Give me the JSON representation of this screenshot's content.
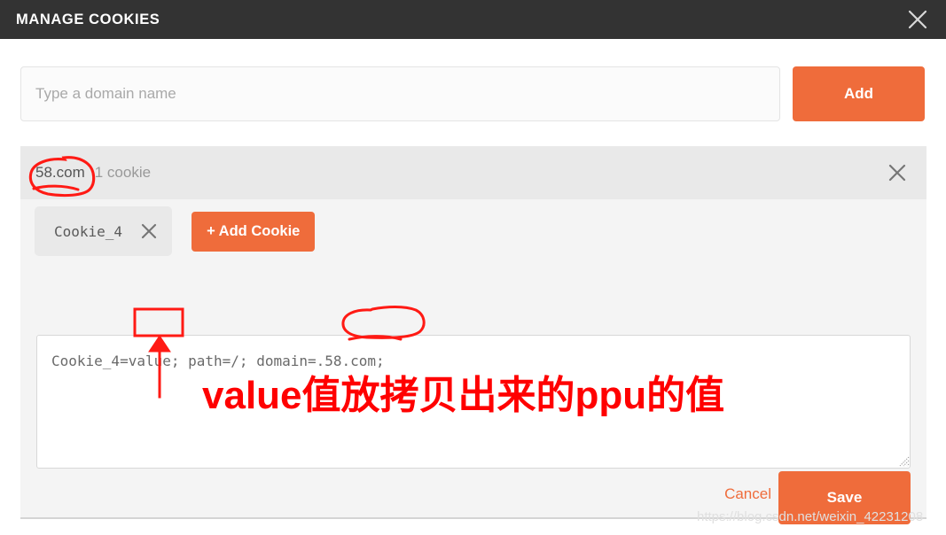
{
  "titlebar": {
    "title": "MANAGE COOKIES",
    "close_icon": "close-icon"
  },
  "add_row": {
    "domain_input_value": "",
    "domain_input_placeholder": "Type a domain name",
    "add_label": "Add"
  },
  "domain_card": {
    "domain_name": "58.com",
    "cookie_count_label": "1 cookie",
    "close_icon": "close-icon",
    "chip": {
      "label": "Cookie_4",
      "remove_icon": "close-icon"
    },
    "add_cookie_label": "+ Add Cookie",
    "cookie_text": "Cookie_4=value; path=/; domain=.58.com;"
  },
  "footer": {
    "cancel_label": "Cancel",
    "save_label": "Save"
  },
  "annotations": {
    "note_text": "value值放拷贝出来的ppu的值",
    "highlight_value": "value",
    "highlight_domain": ".58.com;",
    "circled_domain": "58.com"
  },
  "watermark": {
    "text": "https://blog.csdn.net/weixin_42231208"
  },
  "colors": {
    "accent": "#ef6c3b",
    "titlebar": "#333333",
    "card": "#f4f4f4",
    "card_header": "#e9e9e9",
    "annotation": "#ff0000"
  }
}
